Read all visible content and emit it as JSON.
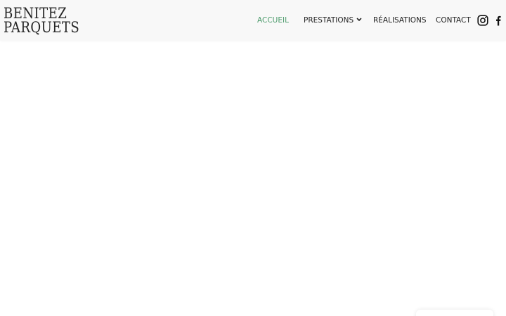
{
  "brand": {
    "line1": "BENITEZ",
    "line2": "PARQUETS"
  },
  "nav": {
    "items": [
      {
        "label": "ACCUEIL",
        "active": true
      },
      {
        "label": "PRESTATIONS",
        "has_dropdown": true
      },
      {
        "label": "RÉALISATIONS"
      },
      {
        "label": "CONTACT"
      }
    ],
    "active_color": "#4a9a6a",
    "text_color": "#222222"
  },
  "social": {
    "icons": [
      "instagram-icon",
      "facebook-icon"
    ]
  },
  "colors": {
    "header_background": "#f8f8f8",
    "page_background": "#ffffff"
  }
}
